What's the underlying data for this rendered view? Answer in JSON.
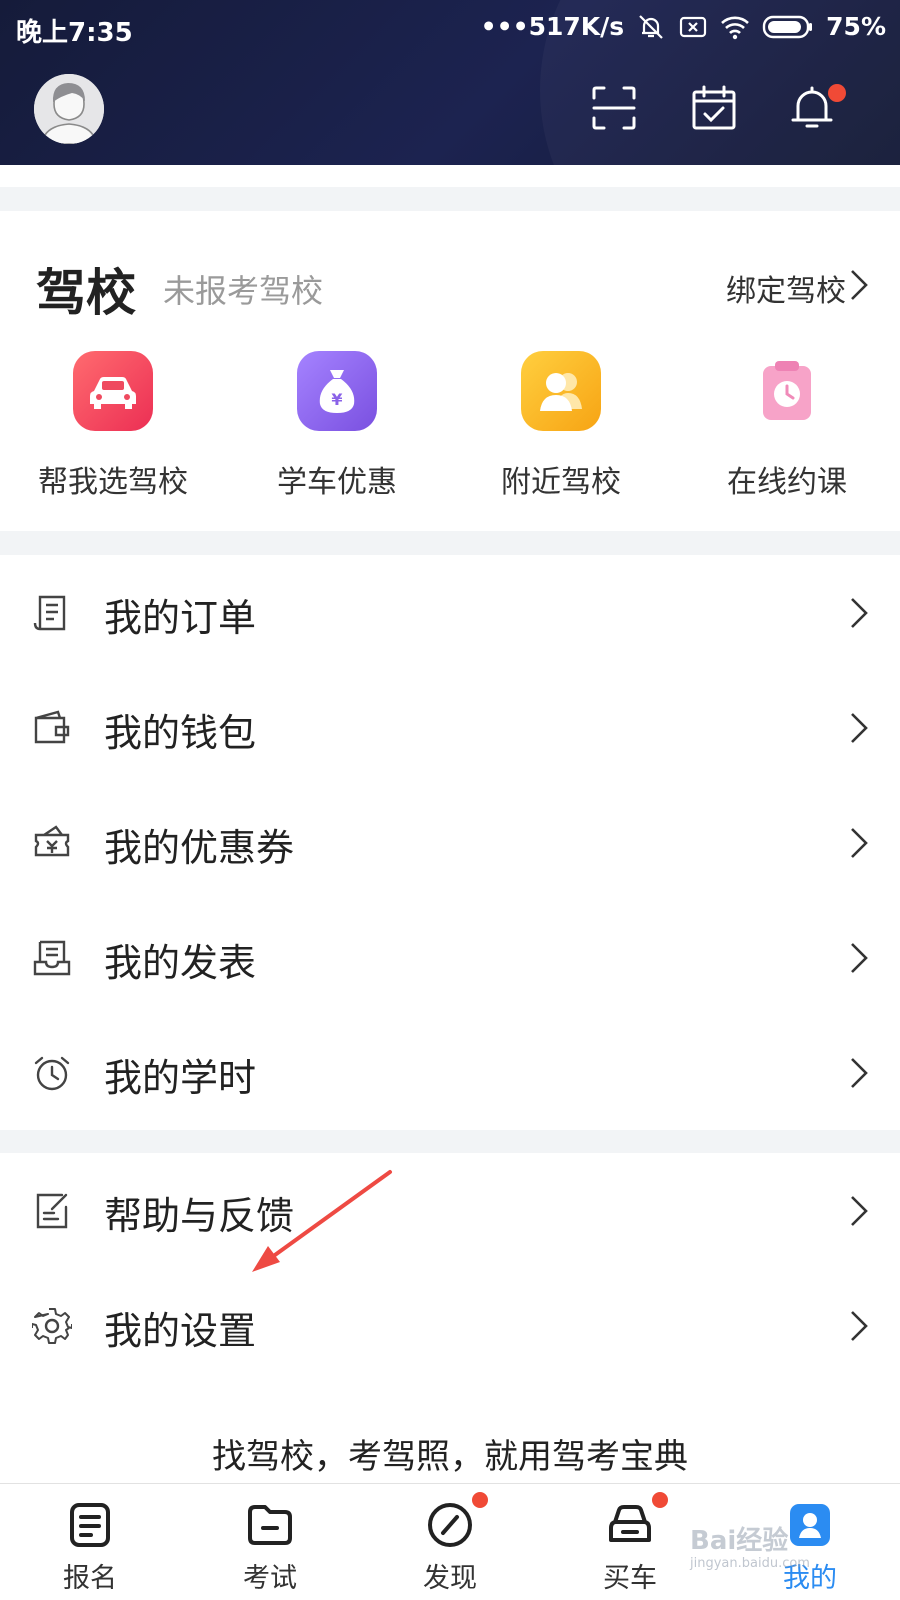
{
  "status_bar": {
    "time": "晚上7:35",
    "network_speed": "•••517K/s",
    "battery": "75%"
  },
  "header": {
    "avatar": "avatar",
    "icons": [
      "scan-icon",
      "checkin-calendar-icon",
      "bell-icon"
    ],
    "notification_dot_color": "#f04a36"
  },
  "school": {
    "title": "驾校",
    "subtitle": "未报考驾校",
    "bind_label": "绑定驾校",
    "shortcuts": [
      {
        "label": "帮我选驾校",
        "icon": "car-icon",
        "color": "#f03f5b"
      },
      {
        "label": "学车优惠",
        "icon": "money-bag-icon",
        "color": "#8a62e8"
      },
      {
        "label": "附近驾校",
        "icon": "people-icon",
        "color": "#f8b31c"
      },
      {
        "label": "在线约课",
        "icon": "clock-clipboard-icon",
        "color": "#f49dc6"
      }
    ]
  },
  "menu_group_1": [
    {
      "label": "我的订单",
      "icon": "order-receipt-icon"
    },
    {
      "label": "我的钱包",
      "icon": "wallet-icon"
    },
    {
      "label": "我的优惠券",
      "icon": "coupon-icon"
    },
    {
      "label": "我的发表",
      "icon": "inbox-post-icon"
    },
    {
      "label": "我的学时",
      "icon": "stopwatch-icon"
    }
  ],
  "menu_group_2": [
    {
      "label": "帮助与反馈",
      "icon": "feedback-edit-icon"
    },
    {
      "label": "我的设置",
      "icon": "settings-gear-icon"
    }
  ],
  "slogan": "找驾校，考驾照，就用驾考宝典",
  "tabbar": [
    {
      "label": "报名",
      "icon": "signup-doc-icon",
      "dot": false
    },
    {
      "label": "考试",
      "icon": "exam-folder-icon",
      "dot": false
    },
    {
      "label": "发现",
      "icon": "compass-icon",
      "dot": true
    },
    {
      "label": "买车",
      "icon": "buy-car-icon",
      "dot": true
    },
    {
      "label": "我的",
      "icon": "profile-icon",
      "dot": false
    }
  ],
  "active_tab": "我的",
  "accent_color": "#2b8cf2",
  "watermark": {
    "text": "Bai经验",
    "url": "jingyan.baidu.com"
  }
}
